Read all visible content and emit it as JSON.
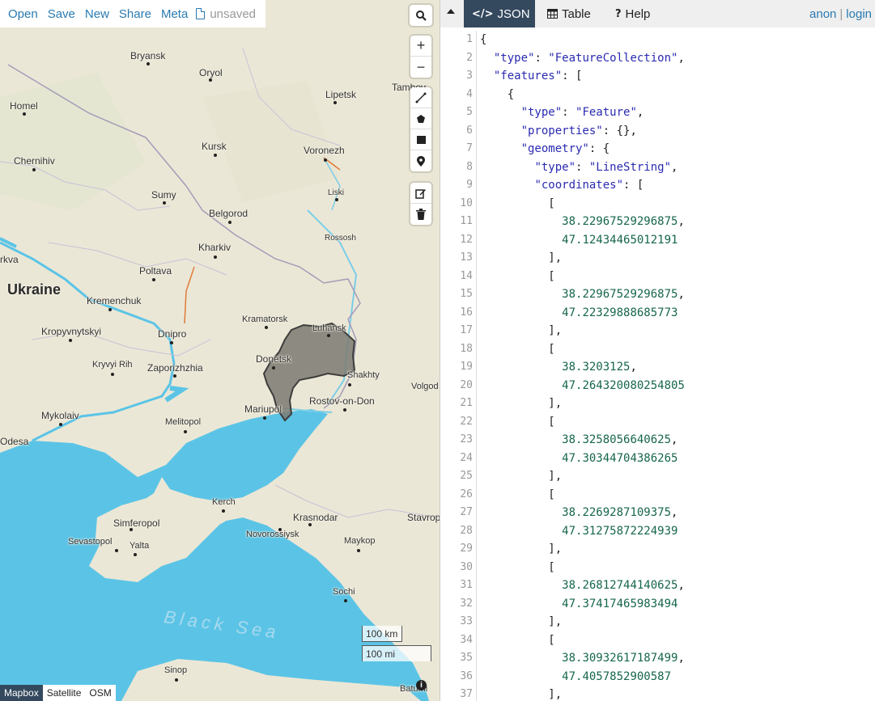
{
  "toolbar": {
    "open": "Open",
    "save": "Save",
    "new": "New",
    "share": "Share",
    "meta": "Meta",
    "unsaved": "unsaved"
  },
  "map": {
    "labels": {
      "bryansk": "Bryansk",
      "oryol": "Oryol",
      "tambov": "Tambov",
      "homel": "Homel",
      "lipetsk": "Lipetsk",
      "kursk": "Kursk",
      "voronezh": "Voronezh",
      "chernihiv": "Chernihiv",
      "sumy": "Sumy",
      "liski": "Liski",
      "belgorod": "Belgorod",
      "rossosh": "Rossosh",
      "kharkiv": "Kharkiv",
      "kyiv": "rkva",
      "poltava": "Poltava",
      "ukraine": "Ukraine",
      "kremenchuk": "Kremenchuk",
      "kramatorsk": "Kramatorsk",
      "luhansk": "Luhansk",
      "kropyvnytskyi": "Kropyvnytskyi",
      "dnipro": "Dnipro",
      "donetsk": "Donetsk",
      "kryvyi_rih": "Kryvyi Rih",
      "zaporizhzhia": "Zaporizhzhia",
      "shakhty": "Shakhty",
      "volgodonsk": "Volgod",
      "rostov": "Rostov-on-Don",
      "mykolaiv": "Mykolaiv",
      "mariupol": "Mariupol",
      "melitopol": "Melitopol",
      "odesa": "Odesa",
      "kerch": "Kerch",
      "simferopol": "Simferopol",
      "krasnodar": "Krasnodar",
      "stavropol": "Stavrop",
      "sevastopol": "Sevastopol",
      "yalta": "Yalta",
      "novorossiysk": "Novorossiysk",
      "maykop": "Maykop",
      "sochi": "Sochi",
      "black_sea": "Black Sea",
      "sinop": "Sinop",
      "batumi": "Batumi"
    },
    "scale_km": "100 km",
    "scale_mi": "100 mi",
    "layers": [
      "Mapbox",
      "Satellite",
      "OSM"
    ],
    "active_layer": "Mapbox",
    "controls": {
      "zoom_in": "+",
      "zoom_out": "−"
    },
    "info": "i"
  },
  "panel": {
    "tabs": [
      {
        "label": "JSON",
        "icon": "code-icon",
        "active": true
      },
      {
        "label": "Table",
        "icon": "table-icon",
        "active": false
      },
      {
        "label": "Help",
        "icon": "help-icon",
        "active": false
      }
    ],
    "auth_user": "anon",
    "auth_sep": "|",
    "auth_login": "login"
  },
  "editor": {
    "line_numbers": [
      "1",
      "2",
      "3",
      "4",
      "5",
      "6",
      "7",
      "8",
      "9",
      "10",
      "11",
      "12",
      "13",
      "14",
      "15",
      "16",
      "17",
      "18",
      "19",
      "20",
      "21",
      "22",
      "23",
      "24",
      "25",
      "26",
      "27",
      "28",
      "29",
      "30",
      "31",
      "32",
      "33",
      "34",
      "35",
      "36",
      "37"
    ],
    "lines": [
      {
        "indent": 0,
        "parts": [
          [
            "p",
            "{"
          ]
        ]
      },
      {
        "indent": 1,
        "parts": [
          [
            "k",
            "\"type\""
          ],
          [
            "p",
            ": "
          ],
          [
            "s",
            "\"FeatureCollection\""
          ],
          [
            "p",
            ","
          ]
        ]
      },
      {
        "indent": 1,
        "parts": [
          [
            "k",
            "\"features\""
          ],
          [
            "p",
            ": ["
          ]
        ]
      },
      {
        "indent": 2,
        "parts": [
          [
            "p",
            "{"
          ]
        ]
      },
      {
        "indent": 3,
        "parts": [
          [
            "k",
            "\"type\""
          ],
          [
            "p",
            ": "
          ],
          [
            "s",
            "\"Feature\""
          ],
          [
            "p",
            ","
          ]
        ]
      },
      {
        "indent": 3,
        "parts": [
          [
            "k",
            "\"properties\""
          ],
          [
            "p",
            ": {},"
          ]
        ]
      },
      {
        "indent": 3,
        "parts": [
          [
            "k",
            "\"geometry\""
          ],
          [
            "p",
            ": {"
          ]
        ]
      },
      {
        "indent": 4,
        "parts": [
          [
            "k",
            "\"type\""
          ],
          [
            "p",
            ": "
          ],
          [
            "s",
            "\"LineString\""
          ],
          [
            "p",
            ","
          ]
        ]
      },
      {
        "indent": 4,
        "parts": [
          [
            "k",
            "\"coordinates\""
          ],
          [
            "p",
            ": ["
          ]
        ]
      },
      {
        "indent": 5,
        "parts": [
          [
            "p",
            "["
          ]
        ]
      },
      {
        "indent": 6,
        "parts": [
          [
            "n",
            "38.22967529296875"
          ],
          [
            "p",
            ","
          ]
        ]
      },
      {
        "indent": 6,
        "parts": [
          [
            "n",
            "47.12434465012191"
          ]
        ]
      },
      {
        "indent": 5,
        "parts": [
          [
            "p",
            "],"
          ]
        ]
      },
      {
        "indent": 5,
        "parts": [
          [
            "p",
            "["
          ]
        ]
      },
      {
        "indent": 6,
        "parts": [
          [
            "n",
            "38.22967529296875"
          ],
          [
            "p",
            ","
          ]
        ]
      },
      {
        "indent": 6,
        "parts": [
          [
            "n",
            "47.22329888685773"
          ]
        ]
      },
      {
        "indent": 5,
        "parts": [
          [
            "p",
            "],"
          ]
        ]
      },
      {
        "indent": 5,
        "parts": [
          [
            "p",
            "["
          ]
        ]
      },
      {
        "indent": 6,
        "parts": [
          [
            "n",
            "38.3203125"
          ],
          [
            "p",
            ","
          ]
        ]
      },
      {
        "indent": 6,
        "parts": [
          [
            "n",
            "47.264320080254805"
          ]
        ]
      },
      {
        "indent": 5,
        "parts": [
          [
            "p",
            "],"
          ]
        ]
      },
      {
        "indent": 5,
        "parts": [
          [
            "p",
            "["
          ]
        ]
      },
      {
        "indent": 6,
        "parts": [
          [
            "n",
            "38.3258056640625"
          ],
          [
            "p",
            ","
          ]
        ]
      },
      {
        "indent": 6,
        "parts": [
          [
            "n",
            "47.30344704386265"
          ]
        ]
      },
      {
        "indent": 5,
        "parts": [
          [
            "p",
            "],"
          ]
        ]
      },
      {
        "indent": 5,
        "parts": [
          [
            "p",
            "["
          ]
        ]
      },
      {
        "indent": 6,
        "parts": [
          [
            "n",
            "38.2269287109375"
          ],
          [
            "p",
            ","
          ]
        ]
      },
      {
        "indent": 6,
        "parts": [
          [
            "n",
            "47.31275872224939"
          ]
        ]
      },
      {
        "indent": 5,
        "parts": [
          [
            "p",
            "],"
          ]
        ]
      },
      {
        "indent": 5,
        "parts": [
          [
            "p",
            "["
          ]
        ]
      },
      {
        "indent": 6,
        "parts": [
          [
            "n",
            "38.26812744140625"
          ],
          [
            "p",
            ","
          ]
        ]
      },
      {
        "indent": 6,
        "parts": [
          [
            "n",
            "47.37417465983494"
          ]
        ]
      },
      {
        "indent": 5,
        "parts": [
          [
            "p",
            "],"
          ]
        ]
      },
      {
        "indent": 5,
        "parts": [
          [
            "p",
            "["
          ]
        ]
      },
      {
        "indent": 6,
        "parts": [
          [
            "n",
            "38.30932617187499"
          ],
          [
            "p",
            ","
          ]
        ]
      },
      {
        "indent": 6,
        "parts": [
          [
            "n",
            "47.4057852900587"
          ]
        ]
      },
      {
        "indent": 5,
        "parts": [
          [
            "p",
            "],"
          ]
        ]
      }
    ]
  },
  "colors": {
    "accent": "#2a7ab0",
    "active_tab": "#34495e",
    "sea": "#5bc4e6",
    "land": "#e8e4d4",
    "feature_fill": "#7d7a72"
  }
}
